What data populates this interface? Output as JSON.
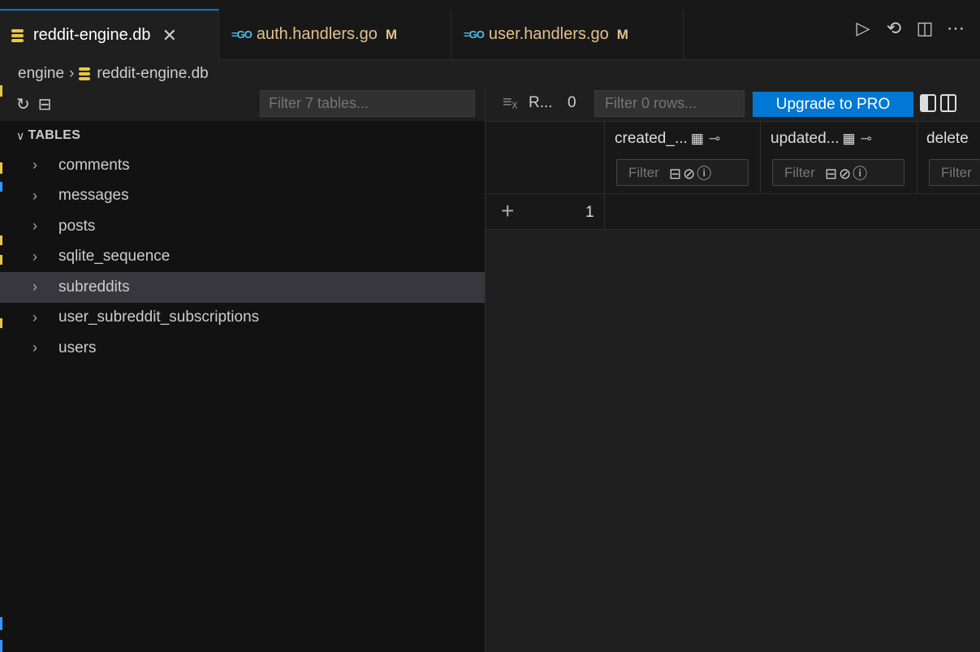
{
  "tabs": [
    {
      "label": "reddit-engine.db",
      "icon": "database-icon",
      "active": true
    },
    {
      "label": "auth.handlers.go",
      "icon": "go-file-icon",
      "modified": "M"
    },
    {
      "label": "user.handlers.go",
      "icon": "go-file-icon",
      "modified": "M"
    }
  ],
  "go_icon_text": "=GO",
  "tab_close_glyph": "✕",
  "breadcrumb": {
    "folder": "engine",
    "file": "reddit-engine.db"
  },
  "sidebar": {
    "filter_placeholder": "Filter 7 tables...",
    "section_title": "TABLES",
    "tables": [
      "comments",
      "messages",
      "posts",
      "sqlite_sequence",
      "subreddits",
      "user_subreddit_subscriptions",
      "users"
    ],
    "selected_table": "subreddits"
  },
  "grid": {
    "rows_label": "R...",
    "rows_count": "0",
    "filter_placeholder": "Filter 0 rows...",
    "upgrade_label": "Upgrade to PRO",
    "columns": [
      {
        "name": "created_...",
        "filter_placeholder": "Filter"
      },
      {
        "name": "updated...",
        "filter_placeholder": "Filter"
      },
      {
        "name": "delete",
        "filter_placeholder": "Filter"
      }
    ],
    "row_number": "1"
  },
  "colors": {
    "accent": "#0078d4",
    "db_icon": "#e8c547",
    "go_icon": "#4fc1e9",
    "modified": "#e2c08d",
    "selected_row": "#37373d"
  }
}
